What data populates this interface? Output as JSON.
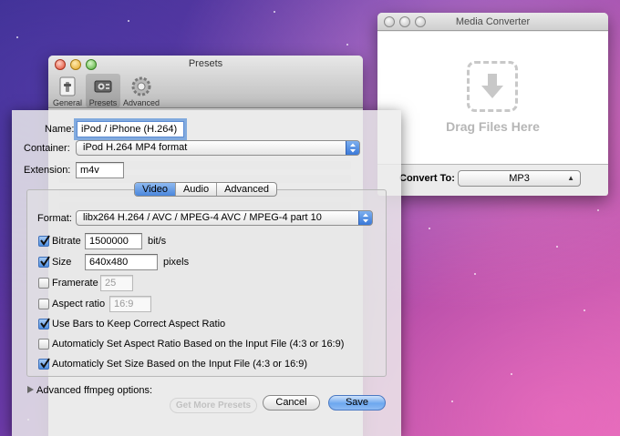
{
  "media_converter": {
    "title": "Media Converter",
    "drop_text": "Drag Files Here",
    "convert_to_label": "Convert To:",
    "convert_to_value": "MP3"
  },
  "presets_window": {
    "title": "Presets",
    "toolbar": [
      {
        "label": "General",
        "icon": "general-icon"
      },
      {
        "label": "Presets",
        "icon": "presets-icon"
      },
      {
        "label": "Advanced",
        "icon": "advanced-icon"
      }
    ],
    "background_button": "Get More Presets"
  },
  "sheet": {
    "name_label": "Name:",
    "name_value": "iPod / iPhone (H.264)",
    "container_label": "Container:",
    "container_value": "iPod H.264 MP4 format",
    "extension_label": "Extension:",
    "extension_value": "m4v",
    "tabs": [
      "Video",
      "Audio",
      "Advanced"
    ],
    "active_tab": "Video",
    "format_label": "Format:",
    "format_value": "libx264 H.264 / AVC / MPEG-4 AVC / MPEG-4 part 10",
    "bitrate": {
      "label": "Bitrate",
      "value": "1500000",
      "unit": "bit/s",
      "checked": true
    },
    "size": {
      "label": "Size",
      "value": "640x480",
      "unit": "pixels",
      "checked": true
    },
    "framerate": {
      "label": "Framerate",
      "value": "25",
      "checked": false
    },
    "aspect_ratio": {
      "label": "Aspect ratio",
      "value": "16:9",
      "checked": false
    },
    "use_bars": {
      "label": "Use Bars to Keep Correct Aspect Ratio",
      "checked": true
    },
    "auto_aspect": {
      "label": "Automaticly Set Aspect Ratio Based on the Input File (4:3 or 16:9)",
      "checked": false
    },
    "auto_size": {
      "label": "Automaticly Set Size Based on the Input File (4:3 or 16:9)",
      "checked": true
    },
    "advanced_options_label": "Advanced ffmpeg options:",
    "cancel_label": "Cancel",
    "save_label": "Save"
  },
  "colors": {
    "accent": "#4a86dc",
    "desktop": "#6b3aa8"
  }
}
